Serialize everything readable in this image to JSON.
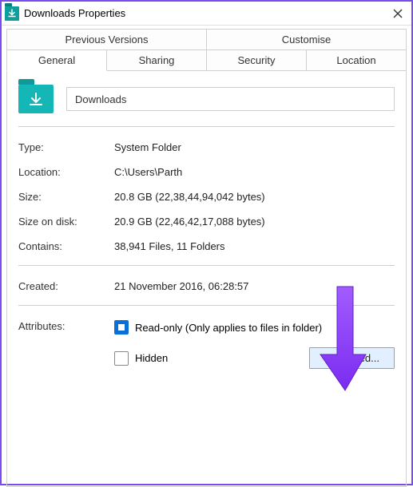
{
  "window": {
    "title": "Downloads Properties"
  },
  "tabs": {
    "row1": [
      "Previous Versions",
      "Customise"
    ],
    "row2": [
      "General",
      "Sharing",
      "Security",
      "Location"
    ],
    "active": "General"
  },
  "folder": {
    "name": "Downloads"
  },
  "fields": {
    "type_label": "Type:",
    "type_value": "System Folder",
    "location_label": "Location:",
    "location_value": "C:\\Users\\Parth",
    "size_label": "Size:",
    "size_value": "20.8 GB (22,38,44,94,042 bytes)",
    "size_on_disk_label": "Size on disk:",
    "size_on_disk_value": "20.9 GB (22,46,42,17,088 bytes)",
    "contains_label": "Contains:",
    "contains_value": "38,941 Files, 11 Folders",
    "created_label": "Created:",
    "created_value": "21 November 2016, 06:28:57"
  },
  "attributes": {
    "label": "Attributes:",
    "readonly": "Read-only (Only applies to files in folder)",
    "hidden": "Hidden",
    "advanced": "Advanced..."
  },
  "icons": {
    "folder": "download-folder-icon",
    "close": "close-icon"
  },
  "annotation": {
    "color": "#8a3cf0"
  }
}
